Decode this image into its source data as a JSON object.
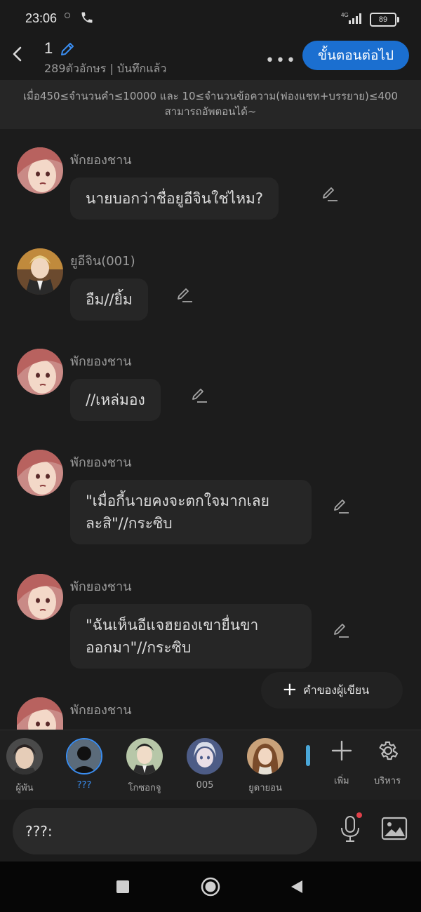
{
  "status_bar": {
    "time": "23:06",
    "network": "4G",
    "battery": "89",
    "icons": [
      "notification-dot-icon",
      "phone-icon",
      "signal-icon",
      "battery-icon"
    ]
  },
  "header": {
    "back_icon": "back-arrow-icon",
    "title": "1",
    "title_edit_icon": "pencil-icon",
    "subtitle": "289ตัวอักษร | บันทึกแล้ว",
    "more_label": "•••",
    "next_button": "ขั้นตอนต่อไป",
    "accent_color": "#1b6fd0"
  },
  "notice": {
    "line1": "เมื่อ450≤จำนวนคำ≤10000 และ 10≤จำนวนข้อความ(ฟองแชท+บรรยาย)≤400",
    "line2": "สามารถอัพตอนได้~"
  },
  "messages": [
    {
      "speaker": "พักยองชาน",
      "avatar": "pink-hair-girl-avatar",
      "text": "นายบอกว่าชื่อยูอีจินใช่ไหม?"
    },
    {
      "speaker": "ยูอีจิน(001)",
      "avatar": "blonde-boy-avatar",
      "text": "อืม//ยิ้ม"
    },
    {
      "speaker": "พักยองชาน",
      "avatar": "pink-hair-girl-avatar",
      "text": "//เหล่มอง"
    },
    {
      "speaker": "พักยองชาน",
      "avatar": "pink-hair-girl-avatar",
      "text_line1": "\"เมื่อกี้นายคงจะตกใจมากเลย",
      "text_line2": "ละสิ\"//กระซิบ"
    },
    {
      "speaker": "พักยองชาน",
      "avatar": "pink-hair-girl-avatar",
      "text_line1": "\"ฉันเห็นอีแจฮยองเขายื่นขา",
      "text_line2": "ออกมา\"//กระซิบ"
    },
    {
      "speaker": "พักยองชาน",
      "avatar": "pink-hair-girl-avatar"
    }
  ],
  "author_words": {
    "plus": "+",
    "label": "คำของผู้เขียน"
  },
  "characters": [
    {
      "label": "ผู้พัน",
      "avatar": "dark-hair-man-avatar"
    },
    {
      "label": "???",
      "avatar": "silhouette-avatar",
      "selected": true
    },
    {
      "label": "โกซอกจู",
      "avatar": "suit-man-avatar"
    },
    {
      "label": "005",
      "avatar": "silver-hair-avatar"
    },
    {
      "label": "ยูดายอน",
      "avatar": "brown-hair-girl-avatar"
    }
  ],
  "char_actions": {
    "add_label": "เพิ่ม",
    "manage_label": "บริหาร"
  },
  "composer": {
    "value": "???:"
  },
  "nav": {
    "icons": [
      "square-recents-icon",
      "circle-home-icon",
      "triangle-back-icon"
    ]
  }
}
